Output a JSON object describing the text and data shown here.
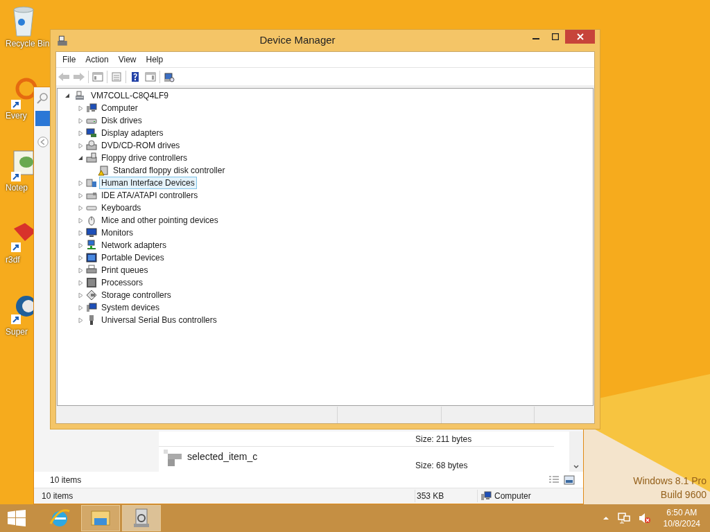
{
  "desktop_icons": [
    {
      "label": "Recycle Bin"
    },
    {
      "label": "Every"
    },
    {
      "label": "Notep"
    },
    {
      "label": "r3df"
    },
    {
      "label": "Super"
    }
  ],
  "explorer_window": {
    "rows": [
      {
        "size": "Size: 211 bytes"
      },
      {
        "name": "selected_item_c",
        "size": "Size: 68 bytes"
      }
    ],
    "item_count": "10 items",
    "status_bar": {
      "items": "10 items",
      "size": "353 KB",
      "location": "Computer"
    }
  },
  "device_manager": {
    "title": "Device Manager",
    "menu": [
      "File",
      "Action",
      "View",
      "Help"
    ],
    "tree": {
      "label": "VM7COLL-C8Q4LF9",
      "expanded": true,
      "selected": false,
      "children": [
        {
          "label": "Computer",
          "expanded": false,
          "selected": false
        },
        {
          "label": "Disk drives",
          "expanded": false,
          "selected": false
        },
        {
          "label": "Display adapters",
          "expanded": false,
          "selected": false
        },
        {
          "label": "DVD/CD-ROM drives",
          "expanded": false,
          "selected": false
        },
        {
          "label": "Floppy drive controllers",
          "expanded": true,
          "selected": false,
          "children": [
            {
              "label": "Standard floppy disk controller",
              "selected": false
            }
          ]
        },
        {
          "label": "Human Interface Devices",
          "expanded": false,
          "selected": true
        },
        {
          "label": "IDE ATA/ATAPI controllers",
          "expanded": false,
          "selected": false
        },
        {
          "label": "Keyboards",
          "expanded": false,
          "selected": false
        },
        {
          "label": "Mice and other pointing devices",
          "expanded": false,
          "selected": false
        },
        {
          "label": "Monitors",
          "expanded": false,
          "selected": false
        },
        {
          "label": "Network adapters",
          "expanded": false,
          "selected": false
        },
        {
          "label": "Portable Devices",
          "expanded": false,
          "selected": false
        },
        {
          "label": "Print queues",
          "expanded": false,
          "selected": false
        },
        {
          "label": "Processors",
          "expanded": false,
          "selected": false
        },
        {
          "label": "Storage controllers",
          "expanded": false,
          "selected": false
        },
        {
          "label": "System devices",
          "expanded": false,
          "selected": false
        },
        {
          "label": "Universal Serial Bus controllers",
          "expanded": false,
          "selected": false
        }
      ]
    }
  },
  "watermark": [
    "Windows 8.1 Pro",
    "Build 9600"
  ],
  "taskbar": {
    "apps": [
      {
        "open": false,
        "selected": false
      },
      {
        "open": true,
        "selected": false
      },
      {
        "open": true,
        "selected": true
      }
    ],
    "volume_muted": true,
    "clock": {
      "time": "6:50 AM",
      "date": "10/8/2024"
    }
  }
}
